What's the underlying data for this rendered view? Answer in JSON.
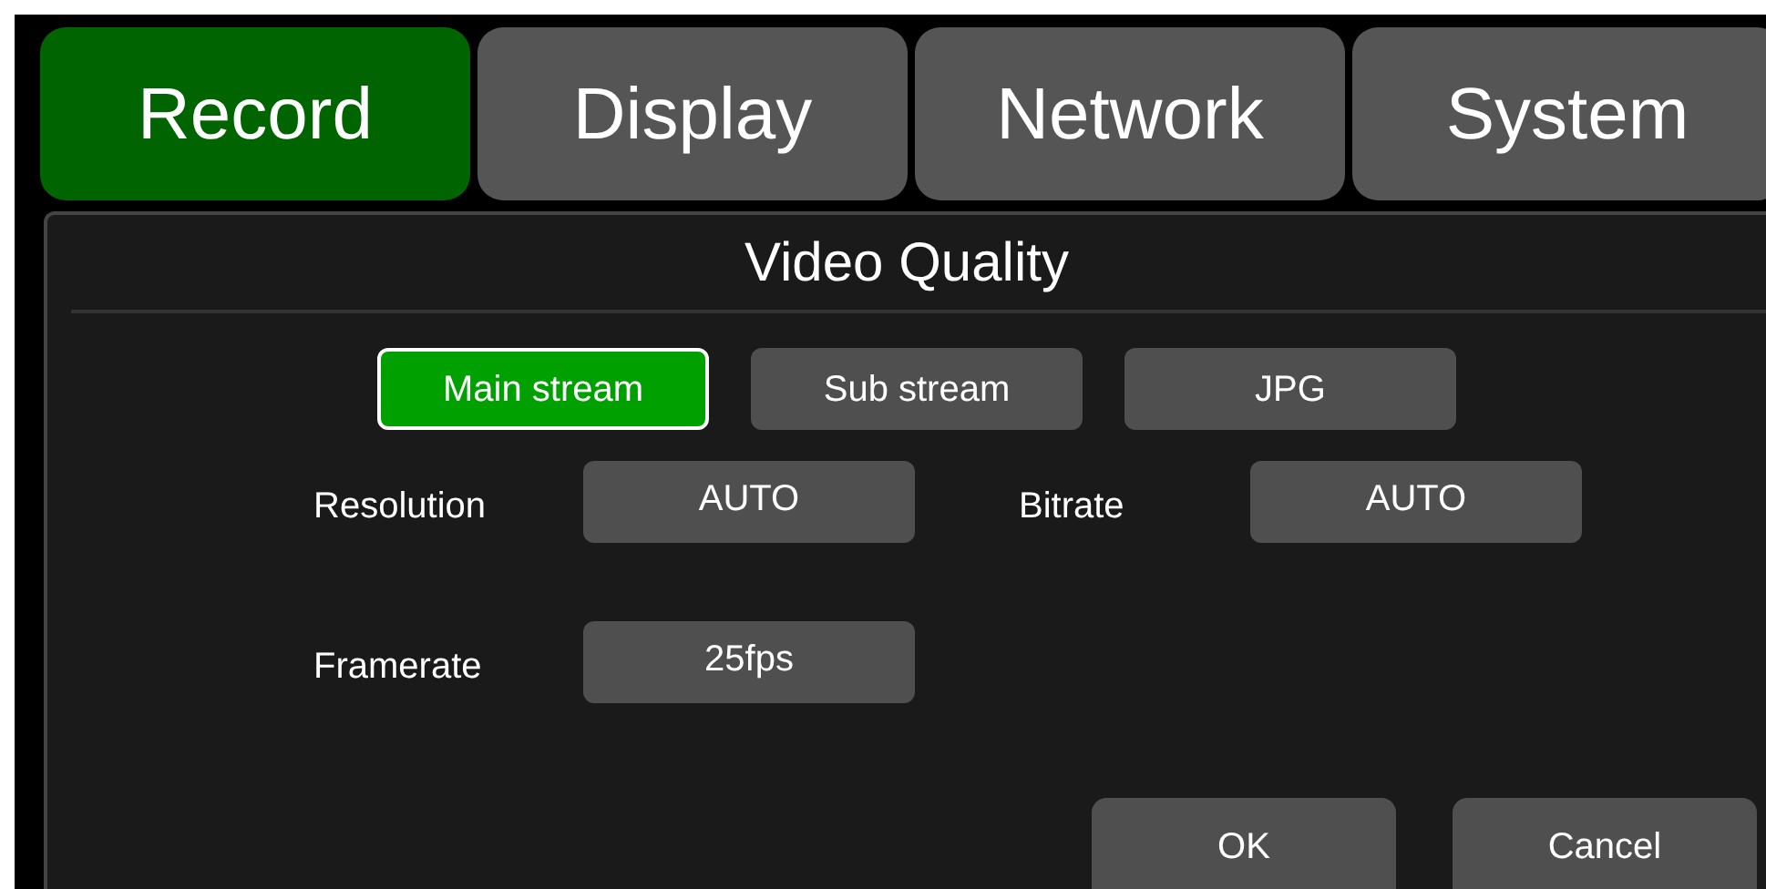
{
  "tabs": [
    {
      "label": "Record",
      "selected": true
    },
    {
      "label": "Display",
      "selected": false
    },
    {
      "label": "Network",
      "selected": false
    },
    {
      "label": "System",
      "selected": false
    }
  ],
  "panel": {
    "title": "Video Quality",
    "streams": [
      {
        "label": "Main stream",
        "selected": true
      },
      {
        "label": "Sub stream",
        "selected": false
      },
      {
        "label": "JPG",
        "selected": false
      }
    ],
    "settings": [
      {
        "label": "Resolution",
        "value": "AUTO"
      },
      {
        "label": "Bitrate",
        "value": "AUTO"
      },
      {
        "label": "Framerate",
        "value": "25fps"
      }
    ],
    "buttons": [
      "OK",
      "Cancel"
    ]
  }
}
